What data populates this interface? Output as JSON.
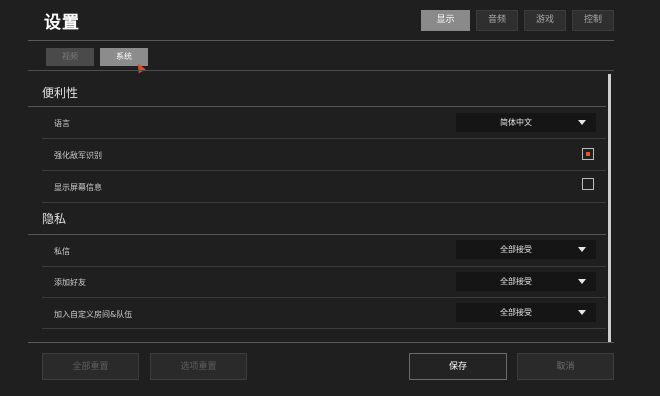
{
  "page": {
    "title": "设置"
  },
  "top_tabs": [
    {
      "label": "显示",
      "active": true
    },
    {
      "label": "音频",
      "active": false
    },
    {
      "label": "游戏",
      "active": false
    },
    {
      "label": "控制",
      "active": false
    }
  ],
  "sub_tabs": [
    {
      "label": "视频",
      "active": false
    },
    {
      "label": "系统",
      "active": true
    }
  ],
  "sections": {
    "convenience": {
      "title": "便利性",
      "language": {
        "label": "语言",
        "value": "简体中文"
      },
      "enemy_highlight": {
        "label": "强化敌军识别",
        "checked": true
      },
      "screen_info": {
        "label": "显示屏幕信息",
        "checked": false
      }
    },
    "privacy": {
      "title": "隐私",
      "private_message": {
        "label": "私信",
        "value": "全部接受"
      },
      "add_friend": {
        "label": "添加好友",
        "value": "全部接受"
      },
      "join_room": {
        "label": "加入自定义房间&队伍",
        "value": "全部接受"
      }
    }
  },
  "footer": {
    "reset_all": "全部重置",
    "reset_option": "选项重置",
    "save": "保存",
    "cancel": "取消"
  },
  "colors": {
    "accent": "#e05a28",
    "active_tab": "#8a8a8a"
  }
}
